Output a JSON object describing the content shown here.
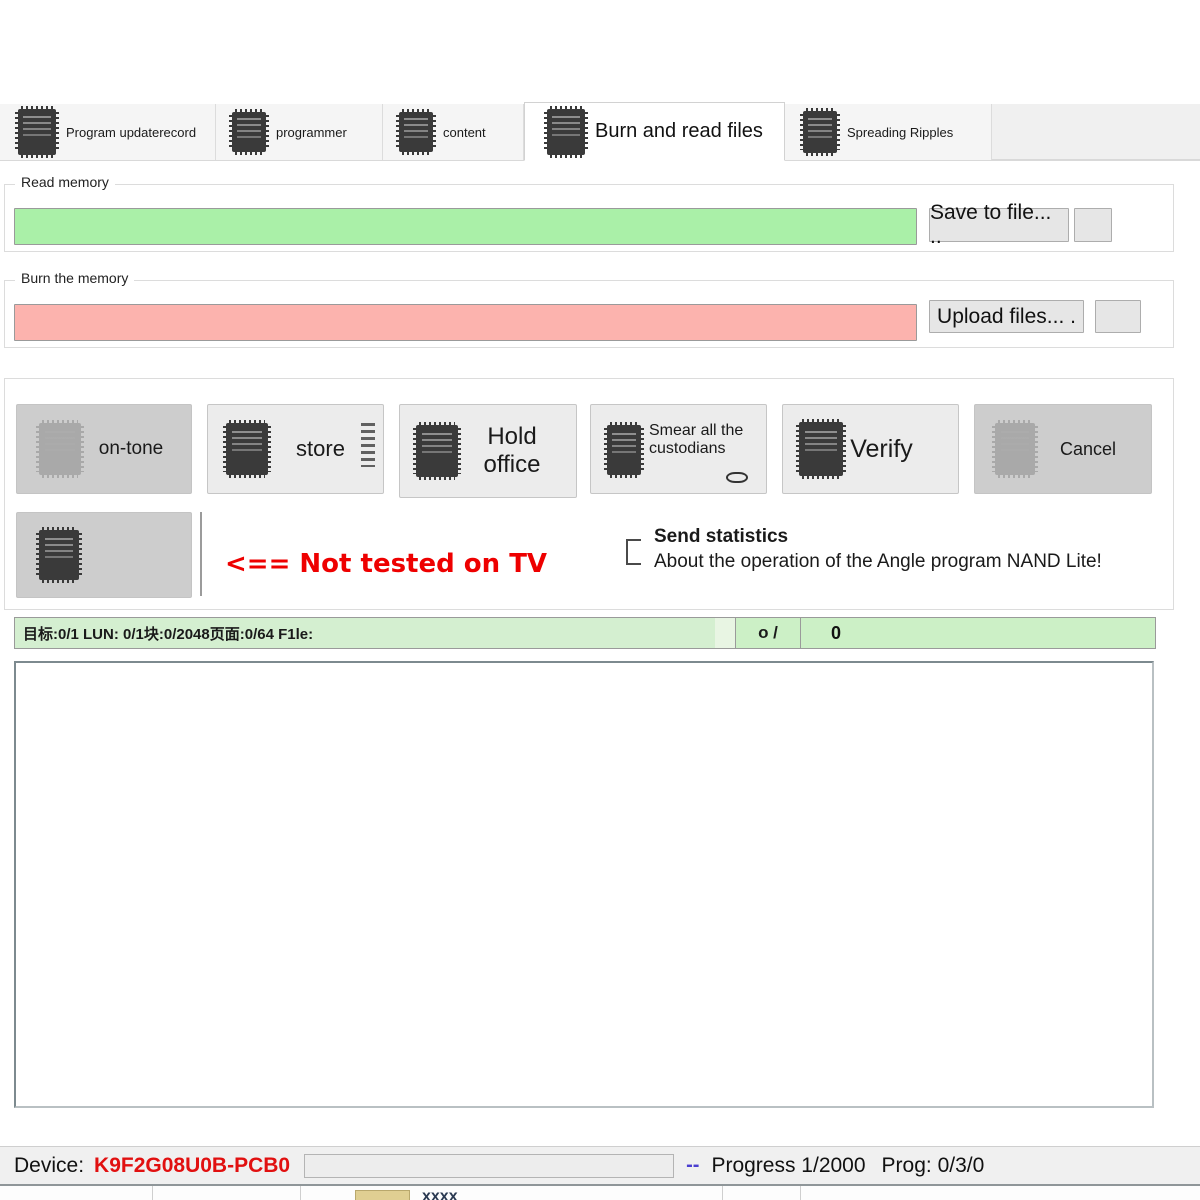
{
  "tabs": [
    {
      "label": "Program updaterecord",
      "icon": "chip-icon",
      "active": false
    },
    {
      "label": "programmer",
      "icon": "chip-icon",
      "active": false
    },
    {
      "label": "content",
      "icon": "chip-icon",
      "active": false
    },
    {
      "label": "Burn and read files",
      "icon": "chip-icon",
      "active": true
    },
    {
      "label": "Spreading Ripples",
      "icon": "chip-icon",
      "active": false
    }
  ],
  "read_memory": {
    "legend": "Read memory",
    "path_value": "",
    "path_placeholder": "",
    "bar_color": "#aaf0a8",
    "save_button": "Save to file... ..",
    "browse_button": ""
  },
  "burn_memory": {
    "legend": "Burn the memory",
    "path_value": "",
    "path_placeholder": "",
    "bar_color": "#fcb3ae",
    "upload_button": "Upload files... .",
    "browse_button": ""
  },
  "actions": [
    {
      "label": "on-tone",
      "icon": "chip-icon",
      "disabled": true,
      "size": "normal"
    },
    {
      "label": "store",
      "icon": "chip-icon",
      "disabled": false,
      "size": "normal"
    },
    {
      "label": "Hold\noffice",
      "icon": "chip-icon",
      "disabled": false,
      "size": "large"
    },
    {
      "label": "Smear all the custodians",
      "icon": "chip-icon",
      "disabled": false,
      "size": "small"
    },
    {
      "label": "Verify",
      "icon": "chip-icon",
      "disabled": false,
      "size": "large"
    },
    {
      "label": "Cancel",
      "icon": "chip-icon",
      "disabled": true,
      "size": "normal"
    }
  ],
  "extra_action": {
    "label": "",
    "icon": "chip-icon",
    "disabled": true
  },
  "red_note": "<== Not tested on TV",
  "stats": {
    "checkbox_icon": "checkbox-bracket-icon",
    "line1": "Send statistics",
    "line2": "About the operation of the Angle program NAND Lite!"
  },
  "progress_row": {
    "target_text": "目标:0/1 LUN: 0/1块:0/2048页面:0/64 F1le:",
    "mid_text": "o /",
    "right_text": "0",
    "track_color": "#ccf0c6"
  },
  "log": {
    "content": ""
  },
  "statusbar": {
    "device_label": "Device:",
    "device_value": "K9F2G08U0B-PCB0",
    "device_field_value": "",
    "dashes": "--",
    "progress_text": "Progress 1/2000",
    "prog_text": "Prog: 0/3/0"
  },
  "bottom_strip": {
    "ghost_text": "xxxx"
  }
}
